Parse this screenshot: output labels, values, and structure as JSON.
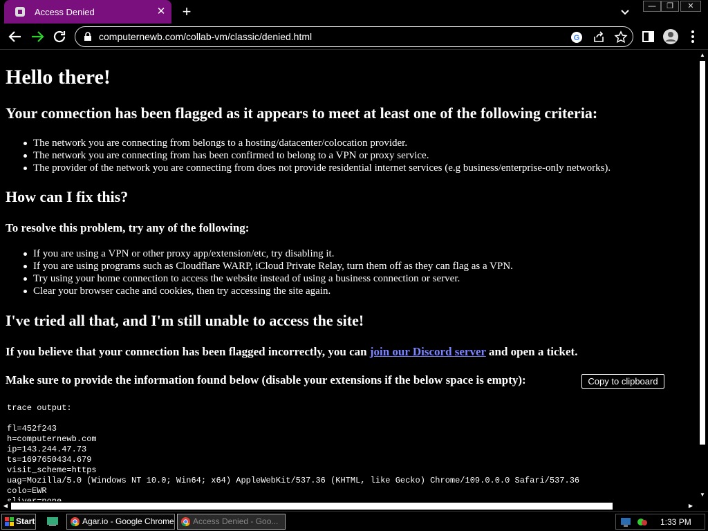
{
  "browser": {
    "tab_title": "Access Denied",
    "tab_color": "#7a0f7e",
    "url": "computernewb.com/collab-vm/classic/denied.html"
  },
  "page": {
    "h1": "Hello there!",
    "h2_flagged": "Your connection has been flagged as it appears to meet at least one of the following criteria:",
    "criteria": [
      "The network you are connecting from belongs to a hosting/datacenter/colocation provider.",
      "The network you are connecting from has been confirmed to belong to a VPN or proxy service.",
      "The provider of the network you are connecting from does not provide residential internet services (e.g business/enterprise-only networks)."
    ],
    "h2_fix": "How can I fix this?",
    "h3_resolve": "To resolve this problem, try any of the following:",
    "fixes": [
      "If you are using a VPN or other proxy app/extension/etc, try disabling it.",
      "If you are using programs such as Cloudflare WARP, iCloud Private Relay, turn them off as they can flag as a VPN.",
      "Try using your home connection to access the website instead of using a business connection or server.",
      "Clear your browser cache and cookies, then try accessing the site again."
    ],
    "h2_tried": "I've tried all that, and I'm still unable to access the site!",
    "ticket_pre": "If you believe that your connection has been flagged incorrectly, you can ",
    "ticket_link": "join our Discord server",
    "ticket_post": " and open a ticket.",
    "info_text": "Make sure to provide the information found below (disable your extensions if the below space is empty):",
    "copy_button": "Copy to clipboard",
    "trace": "trace output:\n\nfl=452f243\nh=computernewb.com\nip=143.244.47.73\nts=1697650434.679\nvisit_scheme=https\nuag=Mozilla/5.0 (Windows NT 10.0; Win64; x64) AppleWebKit/537.36 (KHTML, like Gecko) Chrome/109.0.0.0 Safari/537.36\ncolo=EWR\nsliver=none"
  },
  "taskbar": {
    "start": "Start",
    "tasks": [
      {
        "label": "Agar.io - Google Chrome",
        "active": false
      },
      {
        "label": "Access Denied - Goo...",
        "active": true
      }
    ],
    "clock": "1:33 PM"
  }
}
